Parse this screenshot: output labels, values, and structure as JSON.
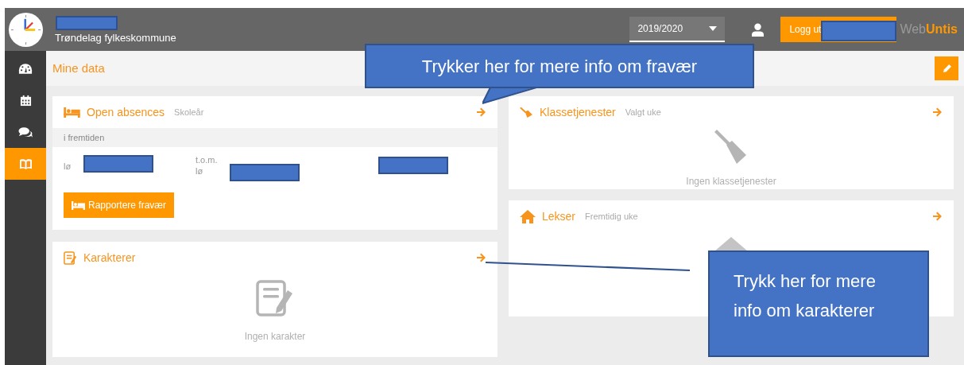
{
  "top_bar": {
    "school": "Trøndelag fylkeskommune",
    "school_year": "2019/2020",
    "logout_label": "Logg ut",
    "brand_prefix": "Web",
    "brand_suffix": "Untis"
  },
  "sidebar": {
    "items": [
      {
        "kind": "dashboard",
        "selected": false
      },
      {
        "kind": "calendar",
        "selected": false
      },
      {
        "kind": "messages",
        "selected": false
      },
      {
        "kind": "book",
        "selected": true
      }
    ]
  },
  "header": {
    "title": "Mine data"
  },
  "left_cards": [
    {
      "kind": "absences",
      "title": "Open absences",
      "subtitle": "Skoleår",
      "section_label": "i fremtiden",
      "from_label": "lø",
      "to_caption": "t.o.m.",
      "to_label": "lø",
      "button": "Rapportere fravær"
    },
    {
      "kind": "grades",
      "title": "Karakterer",
      "empty_text": "Ingen karakter"
    }
  ],
  "right_cards": [
    {
      "kind": "duties",
      "title": "Klassetjenester",
      "subtitle": "Valgt uke",
      "empty_text": "Ingen klassetjenester"
    },
    {
      "kind": "homework",
      "title": "Lekser",
      "subtitle": "Fremtidig uke"
    }
  ],
  "callouts": [
    {
      "text": "Trykker her for mere info om fravær"
    },
    {
      "text": "Trykk her for mere info om karakterer"
    }
  ]
}
